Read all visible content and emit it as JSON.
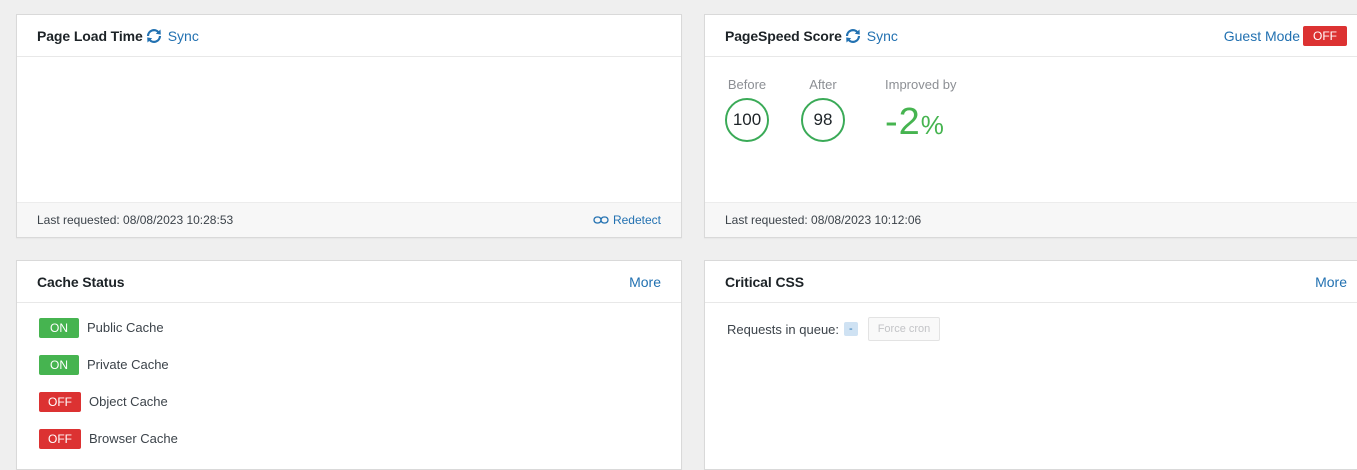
{
  "page_load": {
    "title": "Page Load Time",
    "sync_label": "Sync",
    "last_requested": "Last requested: 08/08/2023 10:28:53",
    "redetect_label": "Redetect"
  },
  "pagespeed": {
    "title": "PageSpeed Score",
    "sync_label": "Sync",
    "guest_mode_label": "Guest Mode",
    "guest_mode_state": "OFF",
    "before_label": "Before",
    "before_value": "100",
    "after_label": "After",
    "after_value": "98",
    "improved_label": "Improved by",
    "improved_value": "-2",
    "improved_unit": "%",
    "last_requested": "Last requested: 08/08/2023 10:12:06"
  },
  "cache_status": {
    "title": "Cache Status",
    "more_label": "More",
    "items": [
      {
        "state": "ON",
        "label": "Public Cache"
      },
      {
        "state": "ON",
        "label": "Private Cache"
      },
      {
        "state": "OFF",
        "label": "Object Cache"
      },
      {
        "state": "OFF",
        "label": "Browser Cache"
      }
    ]
  },
  "critical_css": {
    "title": "Critical CSS",
    "more_label": "More",
    "queue_label": "Requests in queue:",
    "queue_count": "-",
    "force_cron_label": "Force cron"
  },
  "colors": {
    "accent": "#2271b1",
    "on": "#46b450",
    "off": "#dc3232",
    "score_ring": "#3aaa57"
  }
}
